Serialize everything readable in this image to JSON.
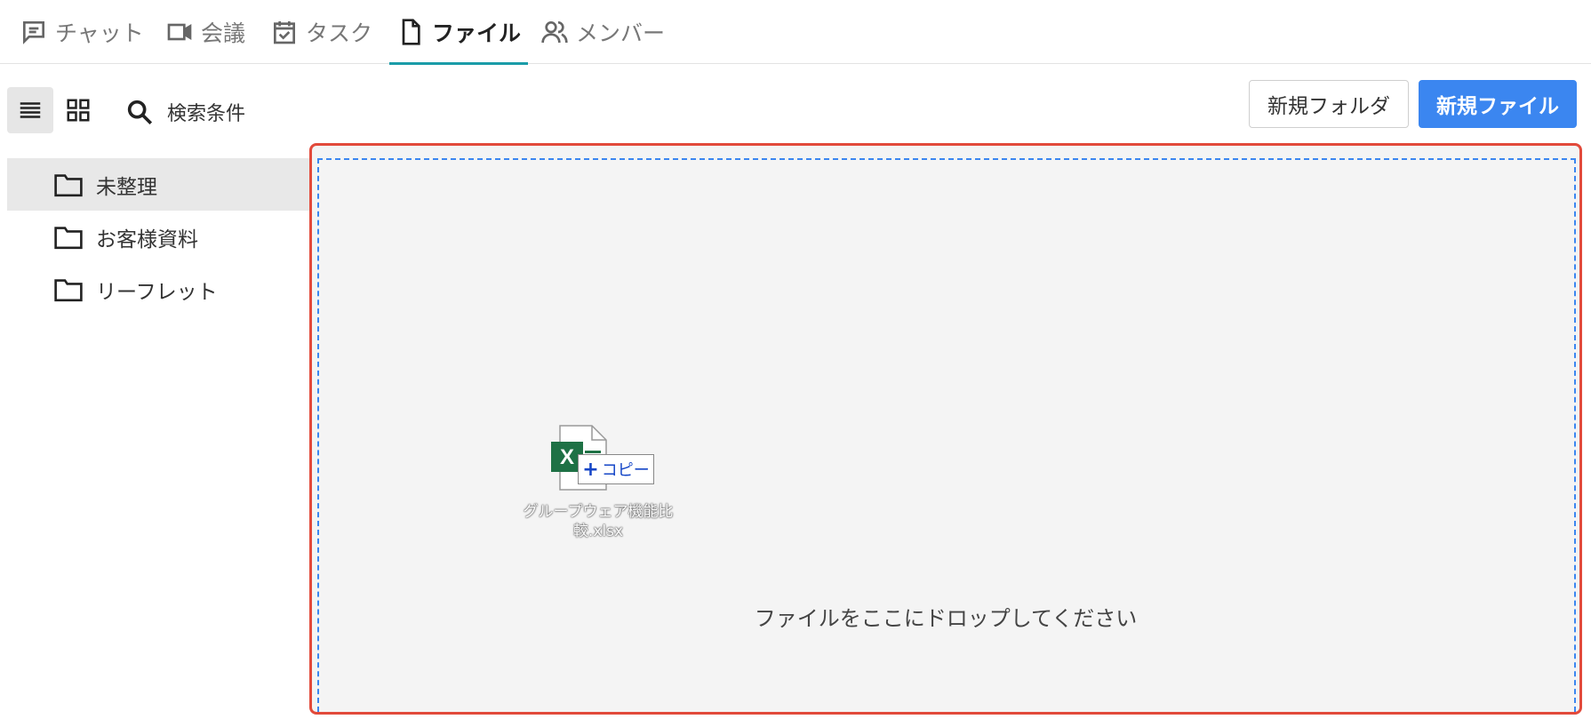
{
  "tabs": [
    {
      "label": "チャット",
      "icon": "chat-icon"
    },
    {
      "label": "会議",
      "icon": "video-icon"
    },
    {
      "label": "タスク",
      "icon": "task-icon"
    },
    {
      "label": "ファイル",
      "icon": "file-icon",
      "active": true
    },
    {
      "label": "メンバー",
      "icon": "members-icon"
    }
  ],
  "toolbar": {
    "search_label": "検索条件",
    "new_folder_label": "新規フォルダ",
    "new_file_label": "新規ファイル"
  },
  "folders": [
    {
      "label": "未整理",
      "selected": true
    },
    {
      "label": "お客様資料"
    },
    {
      "label": "リーフレット"
    }
  ],
  "dropzone": {
    "message": "ファイルをここにドロップしてください",
    "dragged_file": "グループウェア機能比較.xlsx",
    "drag_action": "コピー"
  },
  "colors": {
    "accent": "#1a9ca8",
    "primary": "#3b86f0",
    "highlight": "#e24a3b",
    "excel": "#1e7145"
  }
}
